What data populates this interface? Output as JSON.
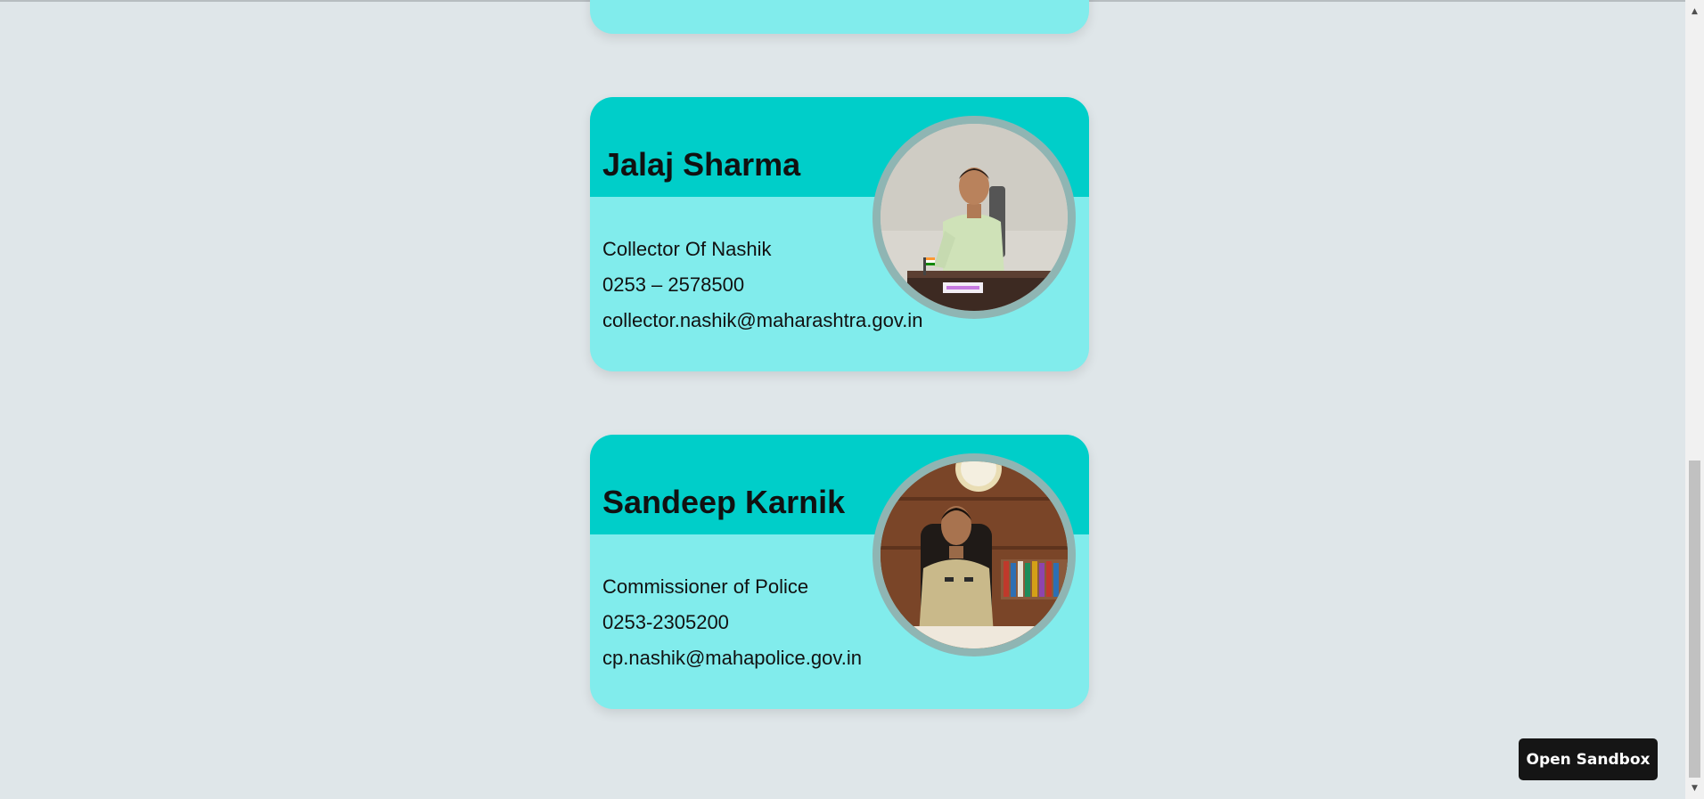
{
  "cards": [
    {
      "name": "Jalaj Sharma",
      "role": "Collector Of Nashik",
      "phone": "0253 – 2578500",
      "email": "collector.nashik@maharashtra.gov.in",
      "photo_icon": "person-photo"
    },
    {
      "name": "Sandeep Karnik",
      "role": "Commissioner of Police",
      "phone": "0253-2305200",
      "email": "cp.nashik@mahapolice.gov.in",
      "photo_icon": "person-photo"
    }
  ],
  "sandbox_button": {
    "label": "Open Sandbox"
  },
  "scrollbar": {
    "up_arrow": "▲",
    "down_arrow": "▼"
  },
  "colors": {
    "page_background": "#dfe6e9",
    "card_header": "#00cec9",
    "card_body": "#81ecec",
    "photo_ring": "#8fb5b3",
    "button_background": "#151515"
  }
}
